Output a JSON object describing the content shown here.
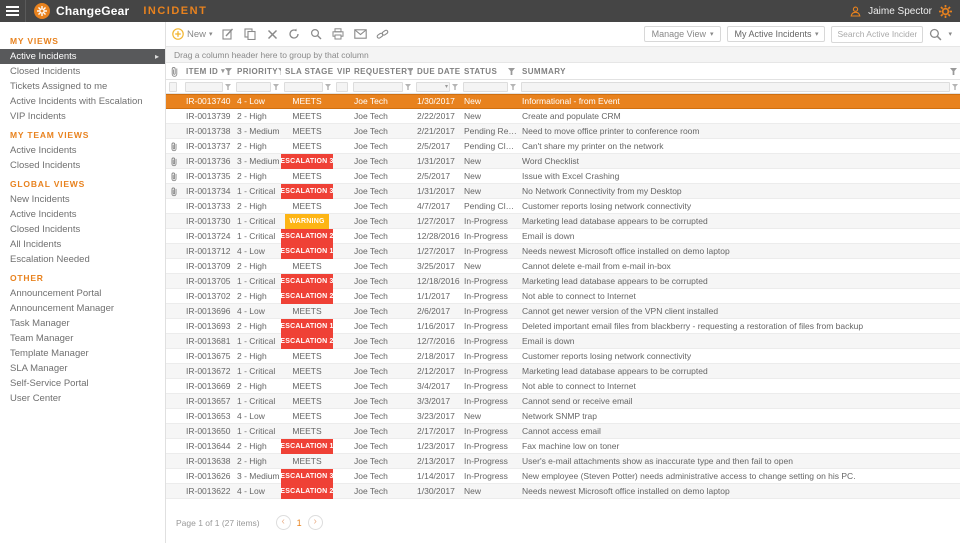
{
  "topbar": {
    "brand": "ChangeGear",
    "module": "INCIDENT",
    "user": "Jaime Spector"
  },
  "sidebar": {
    "sections": [
      {
        "title": "MY VIEWS",
        "items": [
          {
            "label": "Active Incidents",
            "selected": true
          },
          {
            "label": "Closed Incidents"
          },
          {
            "label": "Tickets Assigned to me"
          },
          {
            "label": "Active Incidents with Escalation"
          },
          {
            "label": "VIP Incidents"
          }
        ]
      },
      {
        "title": "MY TEAM VIEWS",
        "items": [
          {
            "label": "Active Incidents"
          },
          {
            "label": "Closed Incidents"
          }
        ]
      },
      {
        "title": "GLOBAL VIEWS",
        "items": [
          {
            "label": "New Incidents"
          },
          {
            "label": "Active Incidents"
          },
          {
            "label": "Closed Incidents"
          },
          {
            "label": "All Incidents"
          },
          {
            "label": "Escalation Needed"
          }
        ]
      },
      {
        "title": "OTHER",
        "items": [
          {
            "label": "Announcement Portal"
          },
          {
            "label": "Announcement Manager"
          },
          {
            "label": "Task Manager"
          },
          {
            "label": "Team Manager"
          },
          {
            "label": "Template Manager"
          },
          {
            "label": "SLA Manager"
          },
          {
            "label": "Self-Service Portal"
          },
          {
            "label": "User Center"
          }
        ]
      }
    ]
  },
  "toolbar": {
    "new_label": "New",
    "icons": [
      "new",
      "edit",
      "copy",
      "delete",
      "refresh",
      "search",
      "print",
      "email",
      "link"
    ],
    "manage_view_label": "Manage View",
    "view_select_value": "My Active Incidents",
    "search_placeholder": "Search Active Incidents"
  },
  "grid": {
    "group_hint": "Drag a column header here to group by that column",
    "columns": [
      "ITEM ID",
      "PRIORITY",
      "SLA STAGE",
      "VIP",
      "REQUESTER",
      "DUE DATE",
      "STATUS",
      "SUMMARY"
    ],
    "sorted_column": "ITEM ID",
    "rows": [
      {
        "id": "IR-0013740",
        "priority": "4 - Low",
        "sla": "MEETS",
        "badge": null,
        "requester": "Joe Tech",
        "due": "1/30/2017",
        "status": "New",
        "summary": "Informational - from Event",
        "selected": true,
        "attach": false
      },
      {
        "id": "IR-0013739",
        "priority": "2 - High",
        "sla": "MEETS",
        "badge": null,
        "requester": "Joe Tech",
        "due": "2/22/2017",
        "status": "New",
        "summary": "Create and populate CRM",
        "attach": false
      },
      {
        "id": "IR-0013738",
        "priority": "3 - Medium",
        "sla": "MEETS",
        "badge": null,
        "requester": "Joe Tech",
        "due": "2/21/2017",
        "status": "Pending Resolu...",
        "summary": "Need to move office printer to conference room",
        "attach": false
      },
      {
        "id": "IR-0013737",
        "priority": "2 - High",
        "sla": "MEETS",
        "badge": null,
        "requester": "Joe Tech",
        "due": "2/5/2017",
        "status": "Pending Close",
        "summary": "Can't share my printer on the network",
        "attach": true
      },
      {
        "id": "IR-0013736",
        "priority": "3 - Medium",
        "sla": "ESCALATION 3",
        "badge": "red",
        "requester": "Joe Tech",
        "due": "1/31/2017",
        "status": "New",
        "summary": "Word Checklist",
        "attach": true
      },
      {
        "id": "IR-0013735",
        "priority": "2 - High",
        "sla": "MEETS",
        "badge": null,
        "requester": "Joe Tech",
        "due": "2/5/2017",
        "status": "New",
        "summary": "Issue with Excel Crashing",
        "attach": true
      },
      {
        "id": "IR-0013734",
        "priority": "1 - Critical",
        "sla": "ESCALATION 3",
        "badge": "red",
        "requester": "Joe Tech",
        "due": "1/31/2017",
        "status": "New",
        "summary": "No Network Connectivity from my Desktop",
        "attach": true
      },
      {
        "id": "IR-0013733",
        "priority": "2 - High",
        "sla": "MEETS",
        "badge": null,
        "requester": "Joe Tech",
        "due": "4/7/2017",
        "status": "Pending Close",
        "summary": "Customer reports losing network connectivity",
        "attach": false
      },
      {
        "id": "IR-0013730",
        "priority": "1 - Critical",
        "sla": "WARNING",
        "badge": "yellow",
        "requester": "Joe Tech",
        "due": "1/27/2017",
        "status": "In-Progress",
        "summary": "Marketing lead database appears to be corrupted",
        "attach": false
      },
      {
        "id": "IR-0013724",
        "priority": "1 - Critical",
        "sla": "ESCALATION 2",
        "badge": "red",
        "requester": "Joe Tech",
        "due": "12/28/2016",
        "status": "In-Progress",
        "summary": "Email is down",
        "attach": false
      },
      {
        "id": "IR-0013712",
        "priority": "4 - Low",
        "sla": "ESCALATION 1",
        "badge": "red",
        "requester": "Joe Tech",
        "due": "1/27/2017",
        "status": "In-Progress",
        "summary": "Needs newest Microsoft office installed on demo laptop",
        "attach": false
      },
      {
        "id": "IR-0013709",
        "priority": "2 - High",
        "sla": "MEETS",
        "badge": null,
        "requester": "Joe Tech",
        "due": "3/25/2017",
        "status": "New",
        "summary": "Cannot delete e-mail from e-mail in-box",
        "attach": false
      },
      {
        "id": "IR-0013705",
        "priority": "1 - Critical",
        "sla": "ESCALATION 3",
        "badge": "red",
        "requester": "Joe Tech",
        "due": "12/18/2016",
        "status": "In-Progress",
        "summary": "Marketing lead database appears to be corrupted",
        "attach": false
      },
      {
        "id": "IR-0013702",
        "priority": "2 - High",
        "sla": "ESCALATION 2",
        "badge": "red",
        "requester": "Joe Tech",
        "due": "1/1/2017",
        "status": "In-Progress",
        "summary": "Not able to connect to Internet",
        "attach": false
      },
      {
        "id": "IR-0013696",
        "priority": "4 - Low",
        "sla": "MEETS",
        "badge": null,
        "requester": "Joe Tech",
        "due": "2/6/2017",
        "status": "In-Progress",
        "summary": "Cannot get newer version of the VPN client installed",
        "attach": false
      },
      {
        "id": "IR-0013693",
        "priority": "2 - High",
        "sla": "ESCALATION 1",
        "badge": "red",
        "requester": "Joe Tech",
        "due": "1/16/2017",
        "status": "In-Progress",
        "summary": "Deleted important email files from blackberry - requesting a restoration of files from backup",
        "attach": false
      },
      {
        "id": "IR-0013681",
        "priority": "1 - Critical",
        "sla": "ESCALATION 2",
        "badge": "red",
        "requester": "Joe Tech",
        "due": "12/7/2016",
        "status": "In-Progress",
        "summary": "Email is down",
        "attach": false
      },
      {
        "id": "IR-0013675",
        "priority": "2 - High",
        "sla": "MEETS",
        "badge": null,
        "requester": "Joe Tech",
        "due": "2/18/2017",
        "status": "In-Progress",
        "summary": "Customer reports losing network connectivity",
        "attach": false
      },
      {
        "id": "IR-0013672",
        "priority": "1 - Critical",
        "sla": "MEETS",
        "badge": null,
        "requester": "Joe Tech",
        "due": "2/12/2017",
        "status": "In-Progress",
        "summary": "Marketing lead database appears to be corrupted",
        "attach": false
      },
      {
        "id": "IR-0013669",
        "priority": "2 - High",
        "sla": "MEETS",
        "badge": null,
        "requester": "Joe Tech",
        "due": "3/4/2017",
        "status": "In-Progress",
        "summary": "Not able to connect to Internet",
        "attach": false
      },
      {
        "id": "IR-0013657",
        "priority": "1 - Critical",
        "sla": "MEETS",
        "badge": null,
        "requester": "Joe Tech",
        "due": "3/3/2017",
        "status": "In-Progress",
        "summary": "Cannot send or receive email",
        "attach": false
      },
      {
        "id": "IR-0013653",
        "priority": "4 - Low",
        "sla": "MEETS",
        "badge": null,
        "requester": "Joe Tech",
        "due": "3/23/2017",
        "status": "New",
        "summary": "Network SNMP trap",
        "attach": false
      },
      {
        "id": "IR-0013650",
        "priority": "1 - Critical",
        "sla": "MEETS",
        "badge": null,
        "requester": "Joe Tech",
        "due": "2/17/2017",
        "status": "In-Progress",
        "summary": "Cannot access email",
        "attach": false
      },
      {
        "id": "IR-0013644",
        "priority": "2 - High",
        "sla": "ESCALATION 1",
        "badge": "red",
        "requester": "Joe Tech",
        "due": "1/23/2017",
        "status": "In-Progress",
        "summary": "Fax machine low on toner",
        "attach": false
      },
      {
        "id": "IR-0013638",
        "priority": "2 - High",
        "sla": "MEETS",
        "badge": null,
        "requester": "Joe Tech",
        "due": "2/13/2017",
        "status": "In-Progress",
        "summary": "User's e-mail attachments show as inaccurate type and then fail to open",
        "attach": false
      },
      {
        "id": "IR-0013626",
        "priority": "3 - Medium",
        "sla": "ESCALATION 3",
        "badge": "red",
        "requester": "Joe Tech",
        "due": "1/14/2017",
        "status": "In-Progress",
        "summary": "New employee (Steven Potter) needs administrative access to change setting on his PC.",
        "attach": false
      },
      {
        "id": "IR-0013622",
        "priority": "4 - Low",
        "sla": "ESCALATION 2",
        "badge": "red",
        "requester": "Joe Tech",
        "due": "1/30/2017",
        "status": "New",
        "summary": "Needs newest Microsoft office installed on demo laptop",
        "attach": false
      }
    ]
  },
  "pagination": {
    "text": "Page 1 of 1 (27 items)",
    "page": "1"
  },
  "colors": {
    "accent_orange": "#e8821e",
    "escalation_red": "#ef4136",
    "warning_yellow": "#fdb515",
    "topbar_bg": "#454545",
    "selected_sidebar": "#58595b"
  }
}
